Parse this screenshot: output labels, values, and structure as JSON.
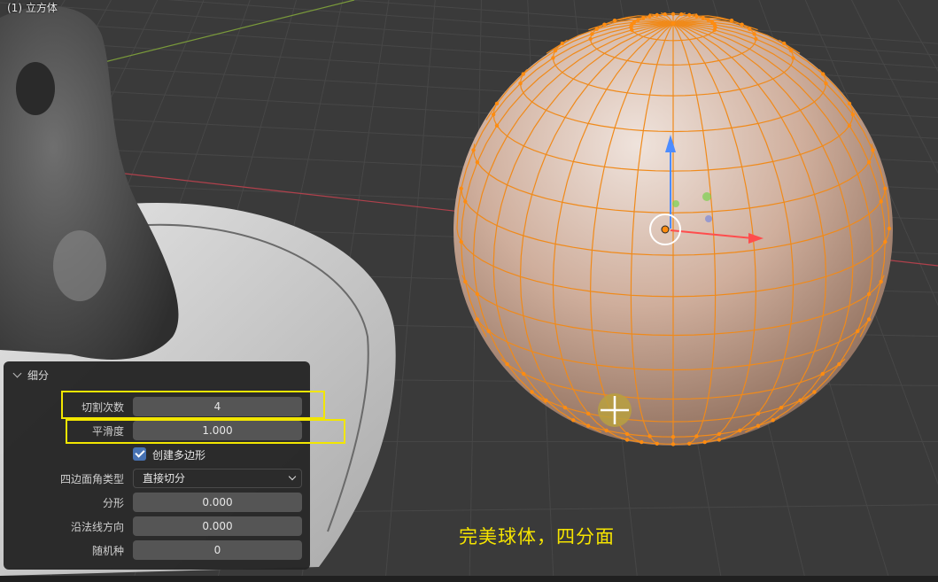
{
  "viewport": {
    "object_label": "(1) 立方体",
    "caption": "完美球体，四分面"
  },
  "subdivide_panel": {
    "title": "细分",
    "fields": {
      "number_of_cuts": {
        "label": "切割次数",
        "value": "4"
      },
      "smoothness": {
        "label": "平滑度",
        "value": "1.000"
      },
      "create_ngons": {
        "label": "创建多边形",
        "checked": true
      },
      "quad_corner_type": {
        "label": "四边面角类型",
        "value": "直接切分"
      },
      "fractal": {
        "label": "分形",
        "value": "0.000"
      },
      "along_normal": {
        "label": "沿法线方向",
        "value": "0.000"
      },
      "random_seed": {
        "label": "随机种",
        "value": "0"
      }
    }
  },
  "colors": {
    "viewport_bg": "#3a3a3a",
    "grid_line": "#454545",
    "x_axis": "#b0414c",
    "y_axis": "#7a9a3a",
    "mesh_edge": "#f08a1a",
    "mesh_fill": "#d8b9a8",
    "highlight": "#f2e600",
    "checkbox": "#4772b3"
  }
}
